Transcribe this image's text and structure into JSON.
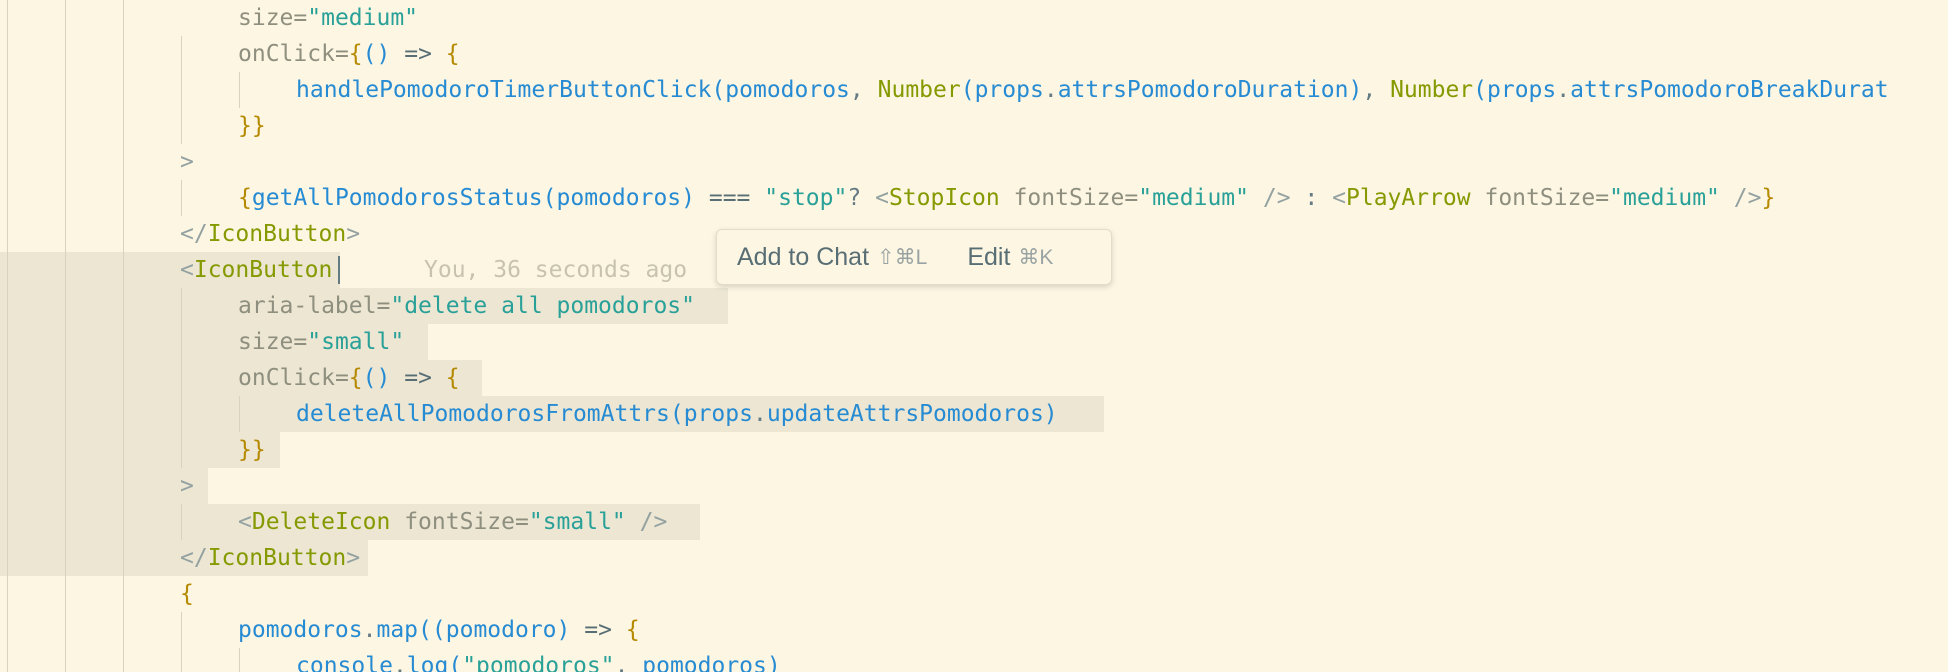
{
  "editor": {
    "lines": [
      [
        "size=\"medium\""
      ],
      [
        "onClick={() => {"
      ],
      [
        "handlePomodoroTimerButtonClick(pomodoros, Number(props.attrsPomodoroDuration), Number(props.attrsPomodoroBreakDurat"
      ],
      [
        "}}"
      ],
      [
        ">"
      ],
      [
        "{getAllPomodorosStatus(pomodoros) === \"stop\"? <StopIcon fontSize=\"medium\" /> : <PlayArrow fontSize=\"medium\" />}"
      ],
      [
        "</IconButton>"
      ],
      [
        "<IconButton"
      ],
      [
        "aria-label=\"delete all pomodoros\""
      ],
      [
        "size=\"small\""
      ],
      [
        "onClick={() => {"
      ],
      [
        "deleteAllPomodorosFromAttrs(props.updateAttrsPomodoros)"
      ],
      [
        "}}"
      ],
      [
        ">"
      ],
      [
        "<DeleteIcon fontSize=\"small\" />"
      ],
      [
        "</IconButton>"
      ],
      [
        "{"
      ],
      [
        "pomodoros.map((pomodoro) => {"
      ],
      [
        "console.log(\"pomodoros\", pomodoros)"
      ]
    ],
    "blame": "You, 36 seconds ago"
  },
  "popup": {
    "add_to_chat_label": "Add to Chat",
    "add_to_chat_shortcut": "⇧⌘L",
    "edit_label": "Edit",
    "edit_shortcut": "⌘K"
  },
  "colors": {
    "background": "#fdf6e3",
    "selection": "#ece6d3",
    "tag": "#859900",
    "string": "#2aa198",
    "function": "#268bd2"
  }
}
